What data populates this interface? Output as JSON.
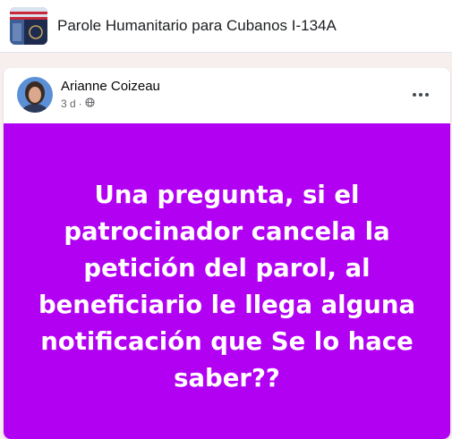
{
  "header": {
    "group_title": "Parole Humanitario para Cubanos I-134A",
    "group_icon": "passport-flag-thumbnail"
  },
  "post": {
    "author": "Arianne Coizeau",
    "time": "3 d",
    "separator": "·",
    "privacy_icon": "globe-icon",
    "more_icon": "more-options-icon",
    "text": "Una pregunta, si el patrocinador cancela la petición del parol, al beneficiario le llega alguna notificación que Se lo hace saber??",
    "background_color": "#b200f3"
  }
}
